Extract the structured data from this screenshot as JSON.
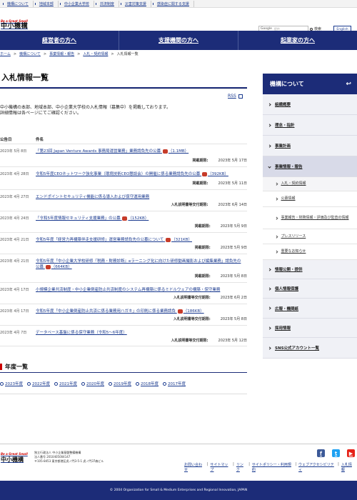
{
  "topbar": {
    "links": [
      "機構について",
      "地域本部",
      "中小企業大学校",
      "共済制度",
      "災害対策支援",
      "感染症に関する支援"
    ]
  },
  "header": {
    "tagline": "Be a Great Small",
    "logo_text": "中小機構",
    "search_brand": "Google",
    "search_placeholder": "提供",
    "search_button": "検索",
    "english_button": "English"
  },
  "nav": {
    "items": [
      "経営者の方へ",
      "支援機関の方へ",
      "起業家の方へ"
    ]
  },
  "breadcrumb": [
    "ホーム",
    "機構について",
    "事業情報・報告",
    "入札・契約情報",
    "入札情報一覧"
  ],
  "main": {
    "title": "入札情報一覧",
    "rss_label": "RSS",
    "intro_line1": "中小機構の本部、地域本部、中小企業大学校の入札情報（募集中）を掲載しております。",
    "intro_line2": "詳細情報は各ページにてご確認ください。",
    "col_date": "公告日",
    "col_name": "件名",
    "rows": [
      {
        "date": "2023年 5月 8日",
        "title": "「第23回 Japan Venture Awards 事務局運営業務」業務請負先の公募",
        "size": "（1.1MB）",
        "deadline_label": "掲載期限:",
        "deadline": "2023年 5月 17日"
      },
      {
        "date": "2023年 4月 28日",
        "title": "令和5年度CEOネットワーク強化事業（環境技術CEO懇談会）の開催に係る業務請負先の公募",
        "size": "（392KB）",
        "deadline_label": "掲載期限:",
        "deadline": "2023年 5月 11日"
      },
      {
        "date": "2023年 4月 27日",
        "title": "エンドポイントセキュリティ機能に係る導入および保守運用業務",
        "size": "",
        "deadline_label": "入札説明書等交付期限:",
        "deadline": "2023年 6月 14日"
      },
      {
        "date": "2023年 4月 24日",
        "title": "「令和5年度情報セキュリティ支援業務」の公募",
        "size": "（152KB）",
        "deadline_label": "掲載期限:",
        "deadline": "2023年 5月 9日"
      },
      {
        "date": "2023年 4月 21日",
        "title": "令和5年度「経営力再構築伴走支援研修」運営業務請負先の公募について",
        "size": "（321KB）",
        "deadline_label": "掲載期限:",
        "deadline": "2023年 5月 9日"
      },
      {
        "date": "2023年 4月 21日",
        "title": "令和5年度「中小企業大学校研修『税務・財務診断』eラーニング化に向けた研修動画撮影および編集業務」請負先の公募",
        "size": "（664KB）",
        "deadline_label": "掲載期限:",
        "deadline": "2023年 5月 8日"
      },
      {
        "date": "2023年 4月 17日",
        "title": "小規模企業共済制度・中小企業倒産防止共済制度のシステム再構築に係るミドルウェアの構築・保守業務",
        "size": "",
        "deadline_label": "入札説明書等交付期限:",
        "deadline": "2023年 6月 2日"
      },
      {
        "date": "2023年 4月 17日",
        "title": "令和5年度「中小企業倒産防止共済に係る業務用ハガキ」の印刷に係る業務請負",
        "size": "（186KB）",
        "deadline_label": "入札説明書等交付期限:",
        "deadline": "2023年 5月 8日"
      },
      {
        "date": "2023年 4月 7日",
        "title": "データベース基盤に係る保守業務（令和5〜6年度）",
        "size": "",
        "deadline_label": "入札説明書等交付期限:",
        "deadline": "2023年 5月 12日"
      }
    ],
    "years_title": "年度一覧",
    "years": [
      "2023年度",
      "2022年度",
      "2021年度",
      "2020年度",
      "2019年度",
      "2018年度",
      "2017年度"
    ]
  },
  "sidebar": {
    "title": "機構について",
    "items": [
      {
        "label": "組織概要"
      },
      {
        "label": "理念・指針"
      },
      {
        "label": "事業計画"
      },
      {
        "label": "事業情報・報告"
      },
      {
        "label": "入札・契約情報",
        "sub": true
      },
      {
        "label": "公募情報",
        "sub": true
      },
      {
        "label": "事業報告・財務情報・評価及び監査の情報",
        "sub": true
      },
      {
        "label": "プレスリリース",
        "sub": true
      },
      {
        "label": "重要なお知らせ",
        "sub": true
      },
      {
        "label": "情報公開・提供"
      },
      {
        "label": "個人情報保護"
      },
      {
        "label": "広報・機関紙"
      },
      {
        "label": "採用情報"
      },
      {
        "label": "SNS公式アカウント一覧"
      }
    ]
  },
  "footer": {
    "tagline": "Be a Great Small",
    "logo_text": "中小機構",
    "address_line1": "独立行政法人 中小企業基盤整備機構",
    "address_line2": "法人番号 2010405004147",
    "address_line3": "〒105-8453 東京都港区虎ノ門3-5-1 虎ノ門37森ビル",
    "links": [
      "お問い合わせ",
      "サイトマップ",
      "リンク",
      "サイトポリシー・利用規約",
      "ウェブアクセシビリティ",
      "入札情報"
    ],
    "copyright": "© 2004 Organization for Small & Medium Enterprises and Regional Innovation, JAPAN"
  },
  "colors": {
    "navy": "#1c2c78",
    "link": "#1a3a8f",
    "accent_red": "#c00"
  }
}
